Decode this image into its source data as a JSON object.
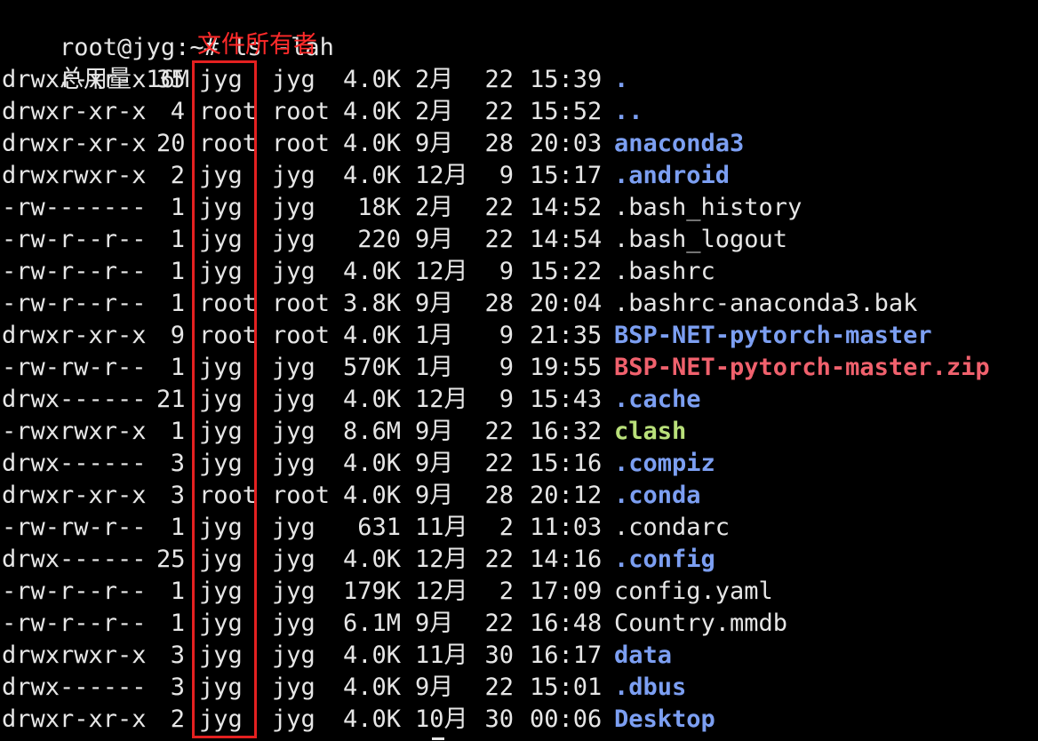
{
  "terminal": {
    "prompt": "root@jyg:~# ls -lah",
    "total": "总用量 16M",
    "annotation": "文件所有者"
  },
  "colors": {
    "directory": "#7c9ff2",
    "archive": "#f0616d",
    "executable": "#b9e07a",
    "regular": "#e6e6e6",
    "highlight_box": "#e42020"
  },
  "entries": [
    {
      "perms": "drwxr-xr-x",
      "links": "35",
      "owner": "jyg",
      "group": "jyg",
      "size": "4.0K",
      "month": "2月",
      "day": "22",
      "time": "15:39",
      "name": ".",
      "kind": "dir"
    },
    {
      "perms": "drwxr-xr-x",
      "links": "4",
      "owner": "root",
      "group": "root",
      "size": "4.0K",
      "month": "2月",
      "day": "22",
      "time": "15:52",
      "name": "..",
      "kind": "dir"
    },
    {
      "perms": "drwxr-xr-x",
      "links": "20",
      "owner": "root",
      "group": "root",
      "size": "4.0K",
      "month": "9月",
      "day": "28",
      "time": "20:03",
      "name": "anaconda3",
      "kind": "dir"
    },
    {
      "perms": "drwxrwxr-x",
      "links": "2",
      "owner": "jyg",
      "group": "jyg",
      "size": "4.0K",
      "month": "12月",
      "day": "9",
      "time": "15:17",
      "name": ".android",
      "kind": "dir"
    },
    {
      "perms": "-rw-------",
      "links": "1",
      "owner": "jyg",
      "group": "jyg",
      "size": "18K",
      "month": "2月",
      "day": "22",
      "time": "14:52",
      "name": ".bash_history",
      "kind": "file"
    },
    {
      "perms": "-rw-r--r--",
      "links": "1",
      "owner": "jyg",
      "group": "jyg",
      "size": "220",
      "month": "9月",
      "day": "22",
      "time": "14:54",
      "name": ".bash_logout",
      "kind": "file"
    },
    {
      "perms": "-rw-r--r--",
      "links": "1",
      "owner": "jyg",
      "group": "jyg",
      "size": "4.0K",
      "month": "12月",
      "day": "9",
      "time": "15:22",
      "name": ".bashrc",
      "kind": "file"
    },
    {
      "perms": "-rw-r--r--",
      "links": "1",
      "owner": "root",
      "group": "root",
      "size": "3.8K",
      "month": "9月",
      "day": "28",
      "time": "20:04",
      "name": ".bashrc-anaconda3.bak",
      "kind": "file"
    },
    {
      "perms": "drwxr-xr-x",
      "links": "9",
      "owner": "root",
      "group": "root",
      "size": "4.0K",
      "month": "1月",
      "day": "9",
      "time": "21:35",
      "name": "BSP-NET-pytorch-master",
      "kind": "dir"
    },
    {
      "perms": "-rw-rw-r--",
      "links": "1",
      "owner": "jyg",
      "group": "jyg",
      "size": "570K",
      "month": "1月",
      "day": "9",
      "time": "19:55",
      "name": "BSP-NET-pytorch-master.zip",
      "kind": "zip"
    },
    {
      "perms": "drwx------",
      "links": "21",
      "owner": "jyg",
      "group": "jyg",
      "size": "4.0K",
      "month": "12月",
      "day": "9",
      "time": "15:43",
      "name": ".cache",
      "kind": "dir"
    },
    {
      "perms": "-rwxrwxr-x",
      "links": "1",
      "owner": "jyg",
      "group": "jyg",
      "size": "8.6M",
      "month": "9月",
      "day": "22",
      "time": "16:32",
      "name": "clash",
      "kind": "exec"
    },
    {
      "perms": "drwx------",
      "links": "3",
      "owner": "jyg",
      "group": "jyg",
      "size": "4.0K",
      "month": "9月",
      "day": "22",
      "time": "15:16",
      "name": ".compiz",
      "kind": "dir"
    },
    {
      "perms": "drwxr-xr-x",
      "links": "3",
      "owner": "root",
      "group": "root",
      "size": "4.0K",
      "month": "9月",
      "day": "28",
      "time": "20:12",
      "name": ".conda",
      "kind": "dir"
    },
    {
      "perms": "-rw-rw-r--",
      "links": "1",
      "owner": "jyg",
      "group": "jyg",
      "size": "631",
      "month": "11月",
      "day": "2",
      "time": "11:03",
      "name": ".condarc",
      "kind": "file"
    },
    {
      "perms": "drwx------",
      "links": "25",
      "owner": "jyg",
      "group": "jyg",
      "size": "4.0K",
      "month": "12月",
      "day": "22",
      "time": "14:16",
      "name": ".config",
      "kind": "dir"
    },
    {
      "perms": "-rw-r--r--",
      "links": "1",
      "owner": "jyg",
      "group": "jyg",
      "size": "179K",
      "month": "12月",
      "day": "2",
      "time": "17:09",
      "name": "config.yaml",
      "kind": "file"
    },
    {
      "perms": "-rw-r--r--",
      "links": "1",
      "owner": "jyg",
      "group": "jyg",
      "size": "6.1M",
      "month": "9月",
      "day": "22",
      "time": "16:48",
      "name": "Country.mmdb",
      "kind": "file"
    },
    {
      "perms": "drwxrwxr-x",
      "links": "3",
      "owner": "jyg",
      "group": "jyg",
      "size": "4.0K",
      "month": "11月",
      "day": "30",
      "time": "16:17",
      "name": "data",
      "kind": "dir"
    },
    {
      "perms": "drwx------",
      "links": "3",
      "owner": "jyg",
      "group": "jyg",
      "size": "4.0K",
      "month": "9月",
      "day": "22",
      "time": "15:01",
      "name": ".dbus",
      "kind": "dir"
    },
    {
      "perms": "drwxr-xr-x",
      "links": "2",
      "owner": "jyg",
      "group": "jyg",
      "size": "4.0K",
      "month": "10月",
      "day": "30",
      "time": "00:06",
      "name": "Desktop",
      "kind": "dir"
    }
  ]
}
